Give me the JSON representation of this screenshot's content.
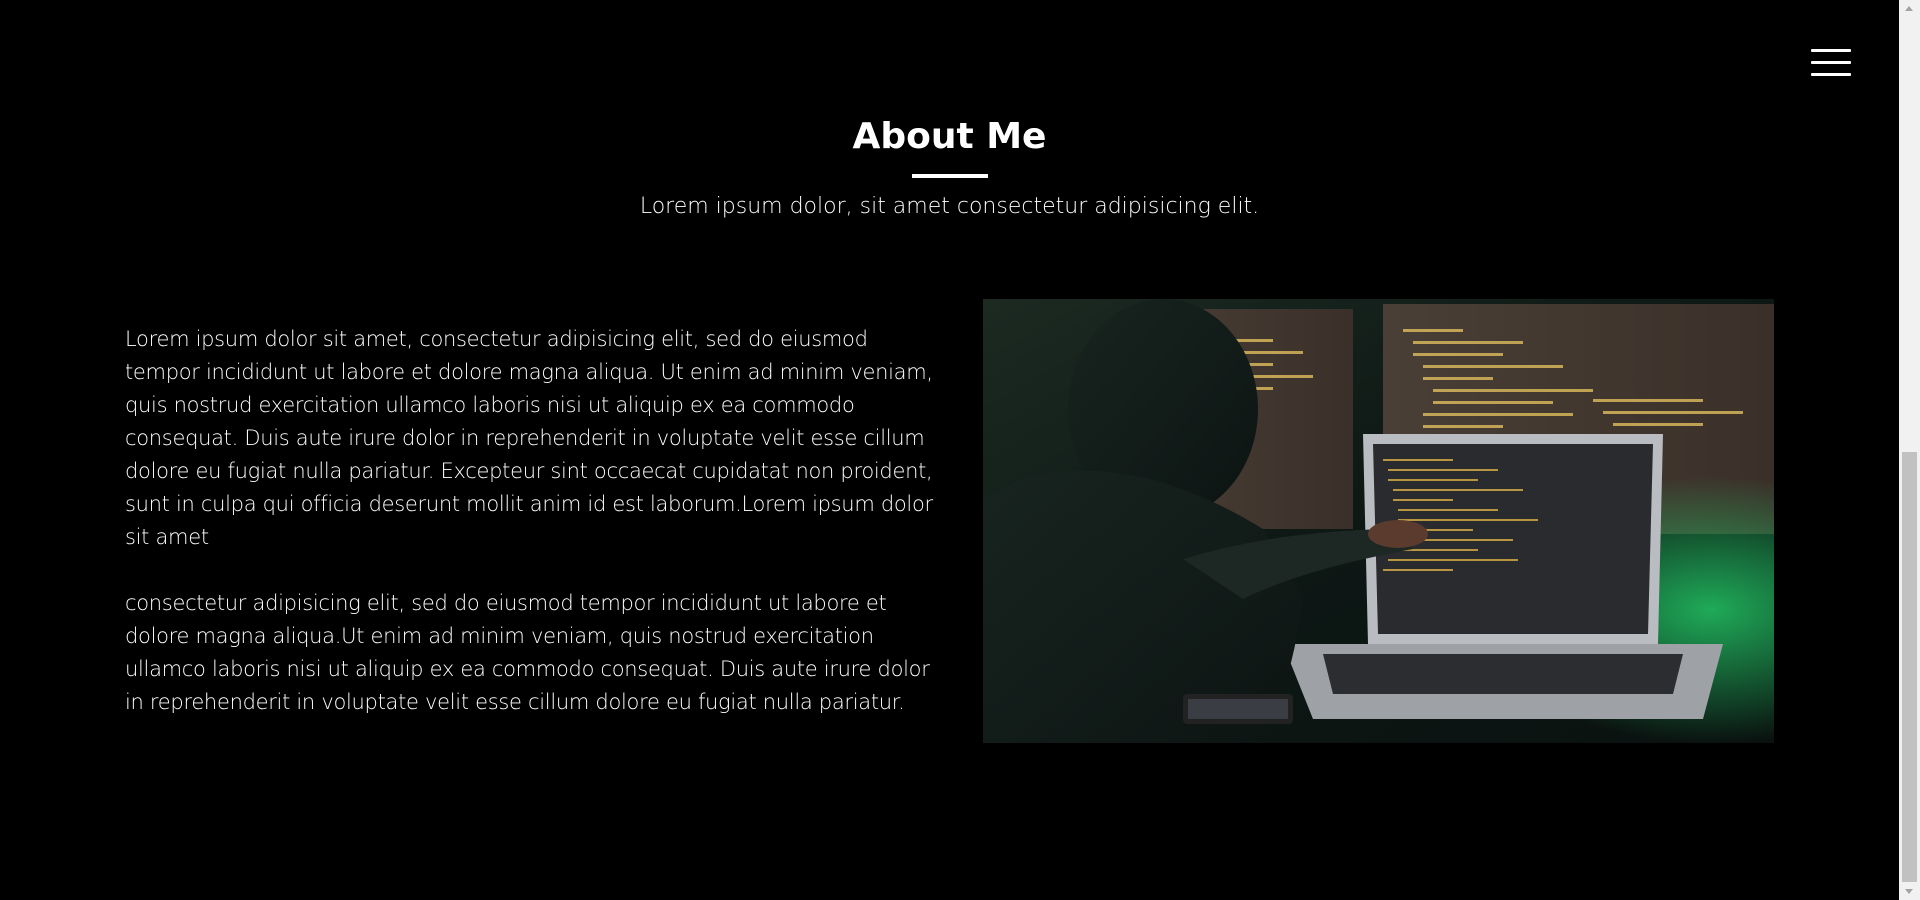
{
  "about": {
    "title": "About Me",
    "subtitle": "Lorem ipsum dolor, sit amet consectetur adipisicing elit.",
    "paragraphs": [
      "Lorem ipsum dolor sit amet, consectetur adipisicing elit, sed do eiusmod tempor incididunt ut labore et dolore magna aliqua. Ut enim ad minim veniam, quis nostrud exercitation ullamco laboris nisi ut aliquip ex ea commodo consequat. Duis aute irure dolor in reprehenderit in voluptate velit esse cillum dolore eu fugiat nulla pariatur. Excepteur sint occaecat cupidatat non proident, sunt in culpa qui officia deserunt mollit anim id est laborum.Lorem ipsum dolor sit amet",
      "consectetur adipisicing elit, sed do eiusmod tempor incididunt ut labore et dolore magna aliqua.Ut enim ad minim veniam, quis nostrud exercitation ullamco laboris nisi ut aliquip ex ea commodo consequat. Duis aute irure dolor in reprehenderit in voluptate velit esse cillum dolore eu fugiat nulla pariatur."
    ]
  },
  "menu": {
    "icon": "hamburger-menu-icon"
  },
  "image": {
    "subject": "developer-at-laptop-image"
  },
  "colors": {
    "background": "#000000",
    "text": "#ffffff",
    "scrollbar_track": "#f1f1f1",
    "scrollbar_thumb": "#c1c1c1"
  }
}
